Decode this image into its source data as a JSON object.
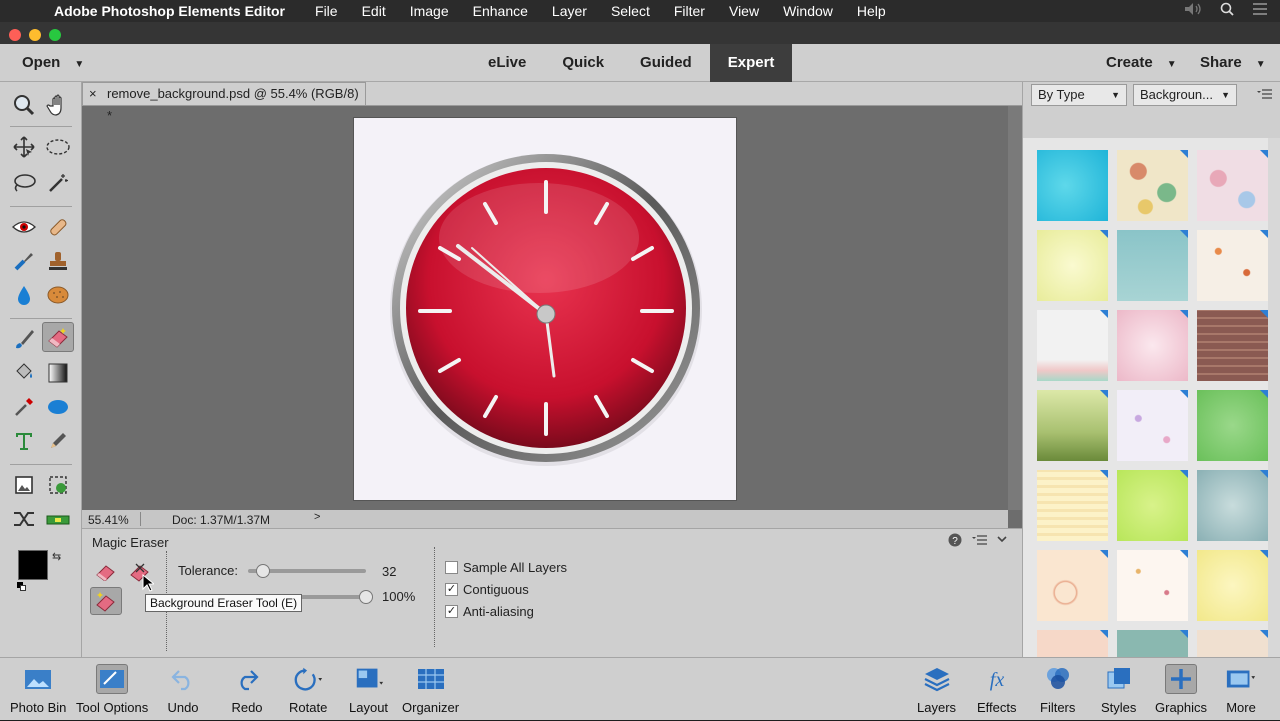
{
  "menubar": {
    "app_name": "Adobe Photoshop Elements Editor",
    "items": [
      "File",
      "Edit",
      "Image",
      "Enhance",
      "Layer",
      "Select",
      "Filter",
      "View",
      "Window",
      "Help"
    ]
  },
  "modebar": {
    "open_label": "Open",
    "modes": [
      "eLive",
      "Quick",
      "Guided",
      "Expert"
    ],
    "active_mode": "Expert",
    "create_label": "Create",
    "share_label": "Share"
  },
  "document": {
    "tab_title": "remove_background.psd @ 55.4% (RGB/8) *",
    "close_glyph": "×"
  },
  "status": {
    "zoom": "55.41%",
    "doc_info": "Doc: 1.37M/1.37M"
  },
  "tool_options": {
    "title": "Magic Eraser",
    "tolerance_label": "Tolerance:",
    "tolerance_value": "32",
    "tolerance_fraction": 0.13,
    "opacity_value": "100%",
    "opacity_fraction": 1.0,
    "sample_all_layers_label": "Sample All Layers",
    "sample_all_layers_checked": false,
    "contiguous_label": "Contiguous",
    "contiguous_checked": true,
    "anti_aliasing_label": "Anti-aliasing",
    "anti_aliasing_checked": true,
    "tooltip": "Background Eraser Tool (E)"
  },
  "right_panel": {
    "filter_by": "By Type",
    "category": "Backgroun..."
  },
  "bottom_bar": {
    "items": [
      "Photo Bin",
      "Tool Options",
      "Undo",
      "Redo",
      "Rotate",
      "Layout",
      "Organizer",
      "Layers",
      "Effects",
      "Filters",
      "Styles",
      "Graphics",
      "More"
    ]
  },
  "colors": {
    "foreground": "#000000",
    "background": "#ffffff",
    "accent_blue": "#2e7fd4",
    "clock_red": "#c8102e"
  }
}
